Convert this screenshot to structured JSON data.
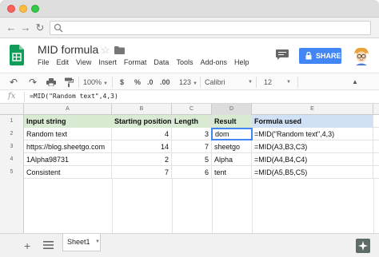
{
  "doc": {
    "title": "MID formula"
  },
  "menu": [
    "File",
    "Edit",
    "View",
    "Insert",
    "Format",
    "Data",
    "Tools",
    "Add-ons",
    "Help"
  ],
  "share_label": "SHARE",
  "toolbar": {
    "zoom": "100%",
    "currency": "$",
    "percent": "%",
    "decimal_dec": ".0",
    "decimal_inc": ".00",
    "number_format": "123",
    "font": "Calibri",
    "font_size": "12"
  },
  "formula_bar": {
    "fx": "fx",
    "text": "=MID(\"Random text\",4,3)"
  },
  "columns": [
    "A",
    "B",
    "C",
    "D",
    "E"
  ],
  "rows": [
    {
      "num": "1",
      "a": "Input string",
      "b": "Starting position",
      "c": "Length",
      "d": "Result",
      "e": "Formula used"
    },
    {
      "num": "2",
      "a": "Random text",
      "b": "4",
      "c": "3",
      "d": "dom",
      "e": "=MID(\"Random text\",4,3)"
    },
    {
      "num": "3",
      "a": "https://blog.sheetgo.com",
      "b": "14",
      "c": "7",
      "d": "sheetgo",
      "e": "=MID(A3,B3,C3)"
    },
    {
      "num": "4",
      "a": "1Alpha98731",
      "b": "2",
      "c": "5",
      "d": "Alpha",
      "e": "=MID(A4,B4,C4)"
    },
    {
      "num": "5",
      "a": "Consistent",
      "b": "7",
      "c": "6",
      "d": "tent",
      "e": "=MID(A5,B5,C5)"
    }
  ],
  "sheets": [
    "Sheet1"
  ],
  "colors": {
    "accent": "#4285f4",
    "header_green": "#d9ead3",
    "header_blue": "#d0e0f5",
    "sheets_green": "#0f9d58"
  }
}
